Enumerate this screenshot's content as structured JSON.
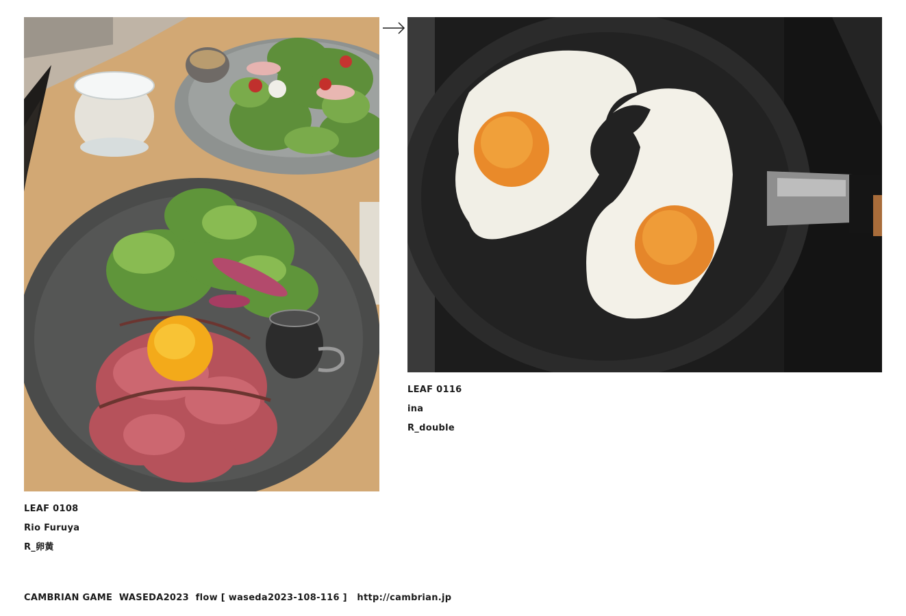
{
  "left_card": {
    "leaf_id": "LEAF 0108",
    "author": "Rio Furuya",
    "title": "R_卵黄",
    "image_alt": "Roast beef bowl with egg yolk and salad"
  },
  "right_card": {
    "leaf_id": "LEAF 0116",
    "author": "ina",
    "title": "R_double",
    "image_alt": "Two fried eggs in a black frying pan"
  },
  "connector_icon": "right-arrow-icon",
  "footer": {
    "game": "CAMBRIAN GAME",
    "event": "WASEDA2023",
    "flow": "flow [ waseda2023-108-116 ]",
    "url": "http://cambrian.jp"
  }
}
